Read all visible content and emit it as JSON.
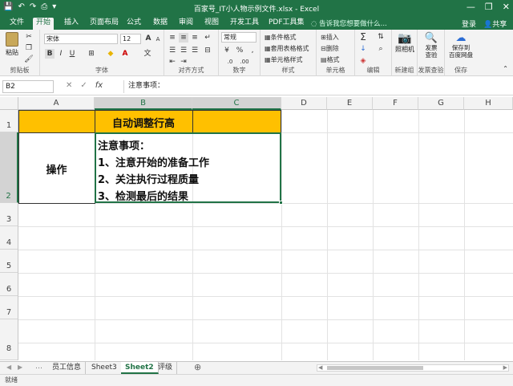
{
  "window": {
    "title": "百家号_IT小人物示例文件.xlsx - Excel",
    "minimize": "—",
    "restore": "❐",
    "close": "✕"
  },
  "qat": {
    "save": "💾",
    "undo": "↶",
    "redo": "↷",
    "preview": "⎙",
    "more": "▾"
  },
  "tabs": [
    "文件",
    "开始",
    "插入",
    "页面布局",
    "公式",
    "数据",
    "审阅",
    "视图",
    "开发工具",
    "PDF工具集"
  ],
  "active_tab": "开始",
  "tell_me": "告诉我您想要做什么...",
  "login": "登录",
  "share": "共享",
  "ribbon": {
    "clipboard": {
      "paste": "粘贴",
      "label": "剪贴板"
    },
    "font": {
      "name": "宋体",
      "size": "12",
      "bold": "B",
      "italic": "I",
      "underline": "U",
      "grow": "A",
      "shrink": "A",
      "label": "字体"
    },
    "alignment": {
      "label": "对齐方式"
    },
    "number": {
      "format": "常规",
      "percent": "%",
      "comma": ",",
      "label": "数字"
    },
    "styles": {
      "cond_format": "条件格式",
      "table_format": "套用表格格式",
      "cell_styles": "单元格样式",
      "label": "样式"
    },
    "cells": {
      "insert": "插入",
      "delete": "删除",
      "format": "格式",
      "label": "单元格"
    },
    "editing": {
      "sum": "Σ",
      "label": "编辑"
    },
    "camera": {
      "label": "照相机"
    },
    "invoice": {
      "button": "发票\n查验",
      "label": "发票查验"
    },
    "save_cloud": {
      "button": "保存到\n百度网盘",
      "label": "保存"
    },
    "new_group": {
      "label": "新建组"
    }
  },
  "formula_bar": {
    "name_box": "B2",
    "cancel": "✕",
    "enter": "✓",
    "fx": "fx",
    "content": "注意事项："
  },
  "columns": [
    "A",
    "B",
    "C",
    "D",
    "E",
    "F",
    "G",
    "H"
  ],
  "rows": [
    "1",
    "2",
    "3",
    "4",
    "5",
    "6",
    "7",
    "8"
  ],
  "cells": {
    "B1": "自动调整行高",
    "A2": "操作",
    "B2_lines": [
      "注意事项：",
      "1、注意开始的准备工作",
      "2、关注执行过程质量",
      "3、检测最后的结果"
    ]
  },
  "colors": {
    "accent": "#217346",
    "header_fill": "#ffc000"
  },
  "sheets": [
    "员工信息",
    "Sheet3",
    "Sheet2",
    "评级"
  ],
  "active_sheet": "Sheet2",
  "add_sheet": "⊕",
  "status": "就绪"
}
